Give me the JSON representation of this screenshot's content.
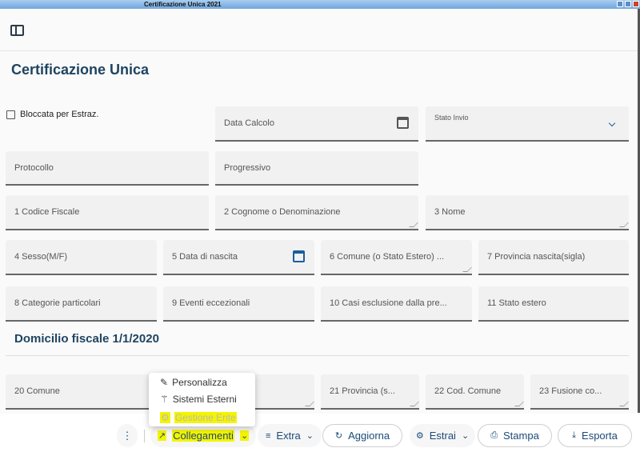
{
  "window": {
    "title": "Certificazione Unica 2021"
  },
  "page": {
    "title": "Certificazione Unica",
    "section_title": "Domicilio fiscale 1/1/2020"
  },
  "form": {
    "bloccata_label": "Bloccata per Estraz.",
    "bloccata_checked": false,
    "data_calcolo": "Data Calcolo",
    "stato_invio": "Stato Invio",
    "protocollo": "Protocollo",
    "progressivo": "Progressivo",
    "codice_fiscale": "1 Codice Fiscale",
    "cognome": "2 Cognome o Denominazione",
    "nome": "3 Nome",
    "sesso": "4 Sesso(M/F)",
    "data_nascita": "5 Data di nascita",
    "comune_nascita": "6 Comune (o Stato Estero) ...",
    "provincia_nascita": "7 Provincia nascita(sigla)",
    "categorie": "8 Categorie particolari",
    "eventi": "9 Eventi eccezionali",
    "casi_esclusione": "10 Casi esclusione dalla pre...",
    "stato_estero": "11 Stato estero",
    "comune": "20 Comune",
    "provincia": "21 Provincia (s...",
    "cod_comune": "22 Cod. Comune",
    "fusione": "23 Fusione co..."
  },
  "menu": {
    "items": [
      {
        "label": "Personalizza",
        "icon": "pencil-icon"
      },
      {
        "label": "Sistemi Esterni",
        "icon": "magic-wand-icon"
      },
      {
        "label": "Gestione Ente",
        "icon": "gears-icon",
        "disabled": true
      }
    ]
  },
  "toolbar": {
    "more": "⋮",
    "collegamenti": "Collegamenti",
    "extra": "Extra",
    "aggiorna": "Aggiorna",
    "estrai": "Estrai",
    "stampa": "Stampa",
    "esporta": "Esporta"
  },
  "colors": {
    "accent": "#1b4a78",
    "highlight": "#f4f400",
    "title": "#1f4461"
  }
}
